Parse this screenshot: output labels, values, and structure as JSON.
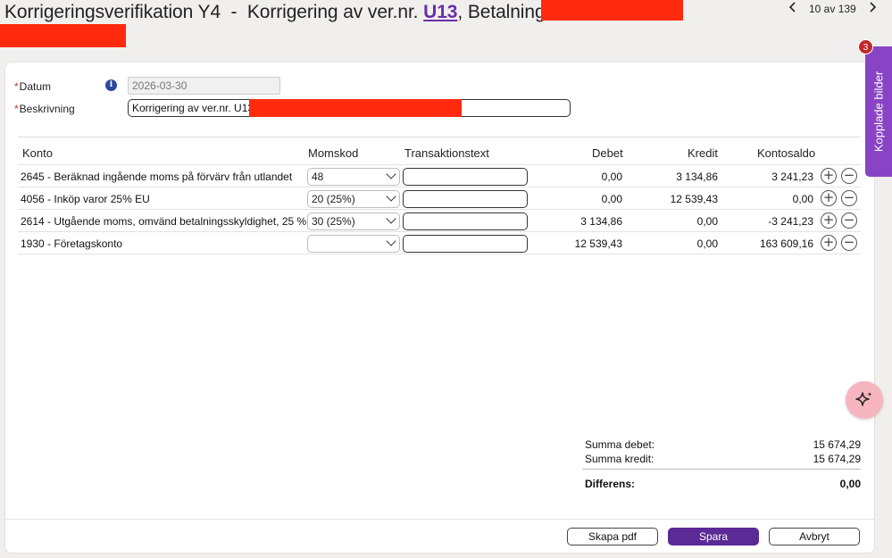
{
  "header": {
    "title_prefix": "Korrigeringsverifikation Y4  -  Korrigering av ver.nr. ",
    "title_link": "U13",
    "title_suffix": ", Betalning till",
    "pager_count": "10 av 139"
  },
  "form": {
    "datum_label": "Datum",
    "datum_value": "2026-03-30",
    "beskrivning_label": "Beskrivning",
    "beskrivning_value": "Korrigering av ver.nr. U13,",
    "required_marker": "*",
    "info_icon_glyph": "i"
  },
  "table": {
    "headers": {
      "konto": "Konto",
      "momskod": "Momskod",
      "transaktionstext": "Transaktionstext",
      "debet": "Debet",
      "kredit": "Kredit",
      "kontosaldo": "Kontosaldo"
    },
    "rows": [
      {
        "konto": "2645 - Beräknad ingående moms på förvärv från utlandet",
        "momskod": "48",
        "transaktionstext": "",
        "debet": "0,00",
        "kredit": "3 134,86",
        "kontosaldo": "3 241,23"
      },
      {
        "konto": "4056 - Inköp varor 25% EU",
        "momskod": "20 (25%)",
        "transaktionstext": "",
        "debet": "0,00",
        "kredit": "12 539,43",
        "kontosaldo": "0,00"
      },
      {
        "konto": "2614 - Utgående moms, omvänd betalningsskyldighet, 25 %",
        "momskod": "30 (25%)",
        "transaktionstext": "",
        "debet": "3 134,86",
        "kredit": "0,00",
        "kontosaldo": "-3 241,23"
      },
      {
        "konto": "1930 - Företagskonto",
        "momskod": "",
        "transaktionstext": "",
        "debet": "12 539,43",
        "kredit": "0,00",
        "kontosaldo": "163 609,16"
      }
    ]
  },
  "summary": {
    "summa_debet_label": "Summa debet:",
    "summa_debet_value": "15 674,29",
    "summa_kredit_label": "Summa kredit:",
    "summa_kredit_value": "15 674,29",
    "differens_label": "Differens:",
    "differens_value": "0,00"
  },
  "buttons": {
    "skapa_pdf": "Skapa pdf",
    "spara": "Spara",
    "avbryt": "Avbryt"
  },
  "side_panel": {
    "label": "Kopplade bilder",
    "badge": "3"
  },
  "icons": {
    "prev": "chevron-left-icon",
    "next": "chevron-right-icon",
    "add_row": "plus-circle-icon",
    "remove_row": "minus-circle-icon",
    "ai": "sparkle-icon",
    "info": "info-icon"
  },
  "colors": {
    "accent": "#5b2a96",
    "link": "#6a2ea8",
    "side_tab": "#8844c4",
    "badge": "#c1272d",
    "redaction": "#ff2a0e",
    "ai_button": "#f6b5bf"
  }
}
